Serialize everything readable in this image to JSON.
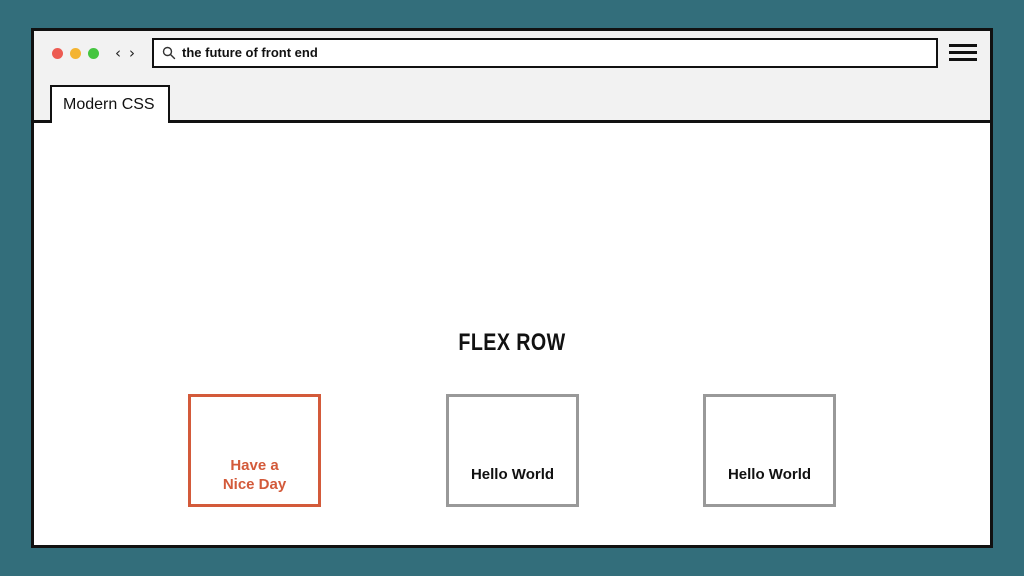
{
  "browser": {
    "address_text": "the future of front end",
    "tab_label": "Modern CSS",
    "window_controls": {
      "close_color": "#ed5b52",
      "minimize_color": "#f4b431",
      "maximize_color": "#45c540"
    },
    "nav": {
      "back_symbol": "‹",
      "forward_symbol": "›"
    },
    "icons": [
      "search-icon",
      "hamburger-menu-icon",
      "chevron-left-icon",
      "chevron-right-icon"
    ]
  },
  "page": {
    "title": "FLEX ROW",
    "boxes": [
      {
        "text": "Have a Nice Day",
        "line1": "Have a",
        "line2": "Nice Day",
        "border_color": "#d35a3a"
      },
      {
        "text": "Hello World",
        "border_color": "#999999"
      },
      {
        "text": "Hello World",
        "border_color": "#999999"
      }
    ]
  },
  "colors": {
    "background": "#336e7b",
    "accent": "#d35a3a",
    "chrome": "#f2f2f2"
  }
}
